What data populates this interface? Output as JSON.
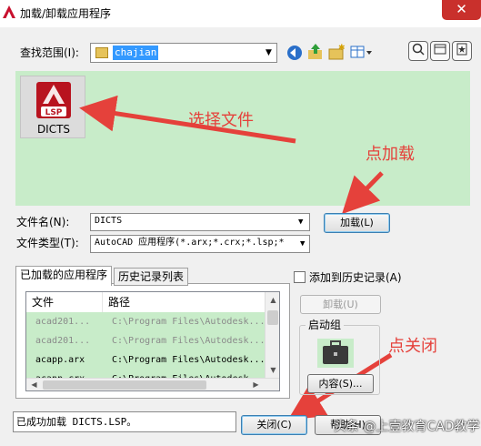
{
  "window": {
    "title": "加载/卸载应用程序",
    "close_glyph": "✕"
  },
  "lookin": {
    "label": "查找范围(I):",
    "value": "chajian"
  },
  "file_browser": {
    "files": [
      {
        "name": "DICTS",
        "badge": "LSP"
      }
    ]
  },
  "annotations": {
    "select_file": "选择文件",
    "click_load": "点加载",
    "click_close": "点关闭"
  },
  "filename": {
    "label": "文件名(N):",
    "value": "DICTS"
  },
  "filetype": {
    "label": "文件类型(T):",
    "value": "AutoCAD 应用程序(*.arx;*.crx;*.lsp;*"
  },
  "buttons": {
    "load": "加载(L)",
    "unload": "卸载(U)",
    "contents": "内容(S)...",
    "close": "关闭(C)",
    "help": "帮助(H)"
  },
  "tabs": {
    "loaded": "已加载的应用程序",
    "history": "历史记录列表"
  },
  "loaded_table": {
    "headers": {
      "file": "文件",
      "path": "路径"
    },
    "rows": [
      {
        "file": "acad201...",
        "path": "C:\\Program Files\\Autodesk..."
      },
      {
        "file": "acad201...",
        "path": "C:\\Program Files\\Autodesk..."
      },
      {
        "file": "acapp.arx",
        "path": "C:\\Program Files\\Autodesk..."
      },
      {
        "file": "acapp.crx",
        "path": "C:\\Program Files\\Autodesk..."
      }
    ]
  },
  "add_history": {
    "label": "添加到历史记录(A)",
    "checked": false
  },
  "startup": {
    "label": "启动组"
  },
  "status": {
    "text": "已成功加载 DICTS.LSP。"
  },
  "watermark": {
    "text": "头条 @上壹教育CAD教学"
  },
  "colors": {
    "pane_green": "#c8ecc9",
    "annotation_red": "#e5413b",
    "close_red": "#c9302c",
    "selection_blue": "#3399ff"
  }
}
